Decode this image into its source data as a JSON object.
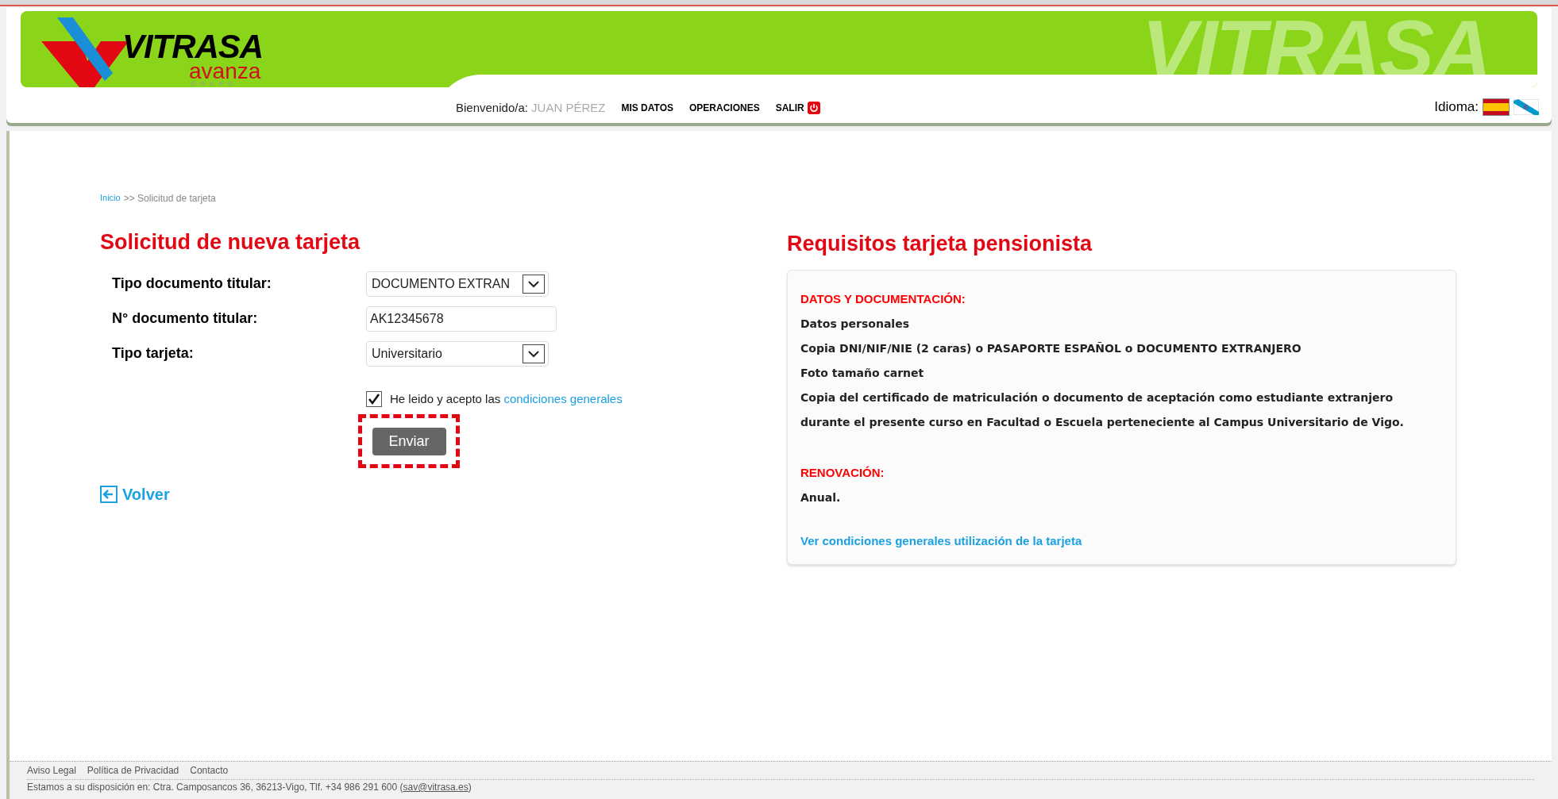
{
  "header": {
    "logo": {
      "name": "VITRASA",
      "group": "avanza",
      "group_sub": "GRUPO"
    },
    "banner_text": "VITRASA",
    "welcome_label": "Bienvenido/a:",
    "user_name": "JUAN PÉREZ",
    "nav": [
      {
        "label": "MIS DATOS",
        "kind": "link"
      },
      {
        "label": "OPERACIONES",
        "kind": "link"
      },
      {
        "label": "SALIR",
        "kind": "logout"
      }
    ],
    "language_label": "Idioma:",
    "languages": [
      {
        "kind": "es",
        "selected": true
      },
      {
        "kind": "gl",
        "selected": false
      }
    ]
  },
  "breadcrumb": {
    "home": "Inicio",
    "separator": ">>",
    "current": "Solicitud de tarjeta"
  },
  "form": {
    "title": "Solicitud de nueva tarjeta",
    "fields": [
      {
        "label": "Tipo documento titular:",
        "kind": "select",
        "value": "DOCUMENTO EXTRAN"
      },
      {
        "label": "N° documento titular:",
        "kind": "text",
        "value": "AK12345678"
      },
      {
        "label": "Tipo tarjeta:",
        "kind": "select",
        "value": "Universitario"
      }
    ],
    "terms": {
      "checked": true,
      "text": "He leido y acepto las",
      "link": "condiciones generales"
    },
    "submit": {
      "label": "Enviar",
      "highlighted": true
    },
    "back": "Volver"
  },
  "requirements": {
    "title": "Requisitos tarjeta pensionista",
    "sections": [
      {
        "heading": "DATOS Y DOCUMENTACIÓN:",
        "lines": [
          "Datos personales",
          "Copia DNI/NIF/NIE (2 caras) o PASAPORTE ESPAÑOL o DOCUMENTO EXTRANJERO",
          "Foto tamaño carnet",
          "Copia del certificado de matriculación o documento de aceptación como estudiante extranjero durante el presente curso en Facultad o Escuela perteneciente al Campus Universitario de Vigo."
        ]
      },
      {
        "heading": "RENOVACIÓN:",
        "lines": [
          "Anual."
        ]
      }
    ],
    "link": "Ver condiciones generales utilización de la tarjeta"
  },
  "footer": {
    "links": [
      "Aviso Legal",
      "Política de Privacidad",
      "Contacto"
    ],
    "contact_text": "Estamos a su disposición en: Ctra. Camposancos 36, 36213-Vigo, Tlf. +34 986 291 600",
    "email_open": "(",
    "email": "sav@vitrasa.es",
    "email_close": ")"
  }
}
